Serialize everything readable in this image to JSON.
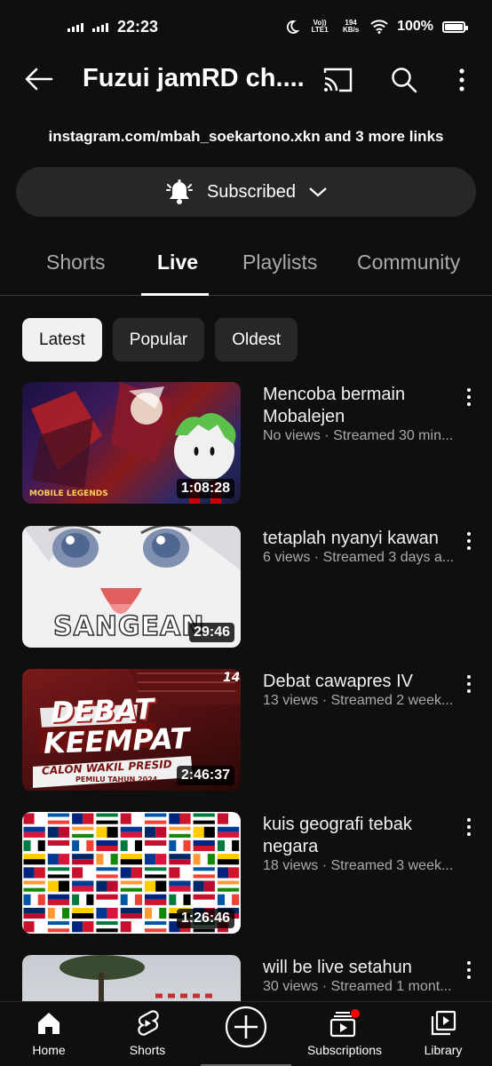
{
  "status_bar": {
    "time": "22:23",
    "volte": "Vo)) LTE1",
    "speed": "194 KB/s",
    "battery": "100%"
  },
  "header": {
    "title": "Fuzui jamRD ch....",
    "back_icon": "back-arrow-icon",
    "cast_icon": "cast-icon",
    "search_icon": "search-icon",
    "more_icon": "more-vert-icon"
  },
  "channel": {
    "links": "instagram.com/mbah_soekartono.xkn and 3 more links",
    "subscribe_label": "Subscribed"
  },
  "tabs": [
    {
      "label": "Shorts",
      "active": false
    },
    {
      "label": "Live",
      "active": true
    },
    {
      "label": "Playlists",
      "active": false
    },
    {
      "label": "Community",
      "active": false
    }
  ],
  "chips": [
    {
      "label": "Latest",
      "active": true
    },
    {
      "label": "Popular",
      "active": false
    },
    {
      "label": "Oldest",
      "active": false
    }
  ],
  "videos": [
    {
      "title": "Mencoba bermain Mobalejen",
      "meta": "No views · Streamed 30 min...",
      "duration": "1:08:28"
    },
    {
      "title": "tetaplah nyanyi kawan",
      "meta": "6 views · Streamed 3 days a...",
      "duration": "29:46",
      "thumb_text": "SANGEAN"
    },
    {
      "title": "Debat cawapres IV",
      "meta": "13 views · Streamed 2 week...",
      "duration": "2:46:37",
      "thumb_text": [
        "DEBAT",
        "KEEMPAT",
        "CALON WAKIL PRESID",
        "PEMILU TAHUN 2024",
        "14"
      ]
    },
    {
      "title": "kuis geografi tebak negara",
      "meta": "18 views · Streamed 3 week...",
      "duration": "1:26:46"
    },
    {
      "title": "will be live setahun",
      "meta": "30 views · Streamed 1 mont..."
    }
  ],
  "bottom_nav": [
    {
      "label": "Home",
      "icon": "home-icon"
    },
    {
      "label": "Shorts",
      "icon": "shorts-icon"
    },
    {
      "label": "",
      "icon": "create-icon"
    },
    {
      "label": "Subscriptions",
      "icon": "subscriptions-icon"
    },
    {
      "label": "Library",
      "icon": "library-icon"
    }
  ],
  "colors": {
    "background": "#0f0f0f",
    "chip": "#272727",
    "secondary_text": "#aaaaaa",
    "notification_dot": "#ff0000"
  }
}
